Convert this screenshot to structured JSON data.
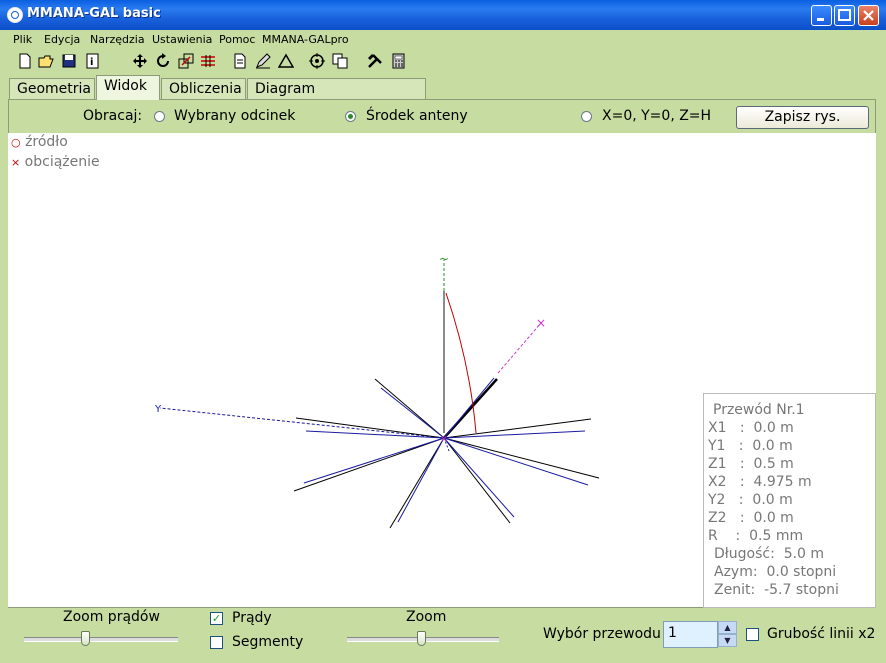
{
  "window": {
    "title": "MMANA-GAL basic"
  },
  "menu": [
    "Plik",
    "Edycja",
    "Narzędzia",
    "Ustawienia",
    "Pomoc",
    "MMANA-GALpro"
  ],
  "toolbar_icons": [
    "new-icon",
    "open-icon",
    "save-icon",
    "info-icon",
    "move-icon",
    "rotate-icon",
    "resize-icon",
    "wires-icon",
    "document-icon",
    "pen-icon",
    "triangle-icon",
    "target-icon",
    "copy-icon",
    "tools-icon",
    "calculator-icon"
  ],
  "tabs": [
    "Geometria",
    "Widok",
    "Obliczenia",
    "Diagram kierunkowości"
  ],
  "active_tab": "Widok",
  "rotate": {
    "label": "Obracaj:",
    "options": [
      "Wybrany odcinek",
      "Środek anteny",
      "X=0, Y=0, Z=H"
    ],
    "selected": "Środek anteny",
    "save_button": "Zapisz rys."
  },
  "legend": {
    "source": "źródło",
    "load": "obciążenie"
  },
  "axis_labels": {
    "z": "~",
    "y": "Y"
  },
  "wire_info": {
    "title": "Przewód Nr.1",
    "x1": "X1   :  0.0 m",
    "y1": "Y1   :  0.0 m",
    "z1": "Z1   :  0.5 m",
    "x2": "X2   :  4.975 m",
    "y2": "Y2   :  0.0 m",
    "z2": "Z2   :  0.0 m",
    "r": "R    :  0.5 mm",
    "length": "Długość:  5.0 m",
    "azimuth": "Azym:  0.0 stopni",
    "zenith": "Zenit:  -5.7 stopni"
  },
  "bottom": {
    "zoom_currents": "Zoom prądów",
    "currents": "Prądy",
    "currents_checked": true,
    "segments": "Segmenty",
    "segments_checked": false,
    "zoom": "Zoom",
    "wire_select_label": "Wybór przewodu",
    "wire_select_value": "1",
    "line_width_x2": "Grubość linii x2",
    "line_width_checked": false
  },
  "colors": {
    "titlebar": "#1a62dd",
    "background": "#c6dca0",
    "wire_black": "#000000",
    "wire_blue": "#1a1aa0",
    "current_red": "#c00000",
    "axis_magenta": "#cc33cc",
    "axis_green": "#2a8a2a"
  }
}
